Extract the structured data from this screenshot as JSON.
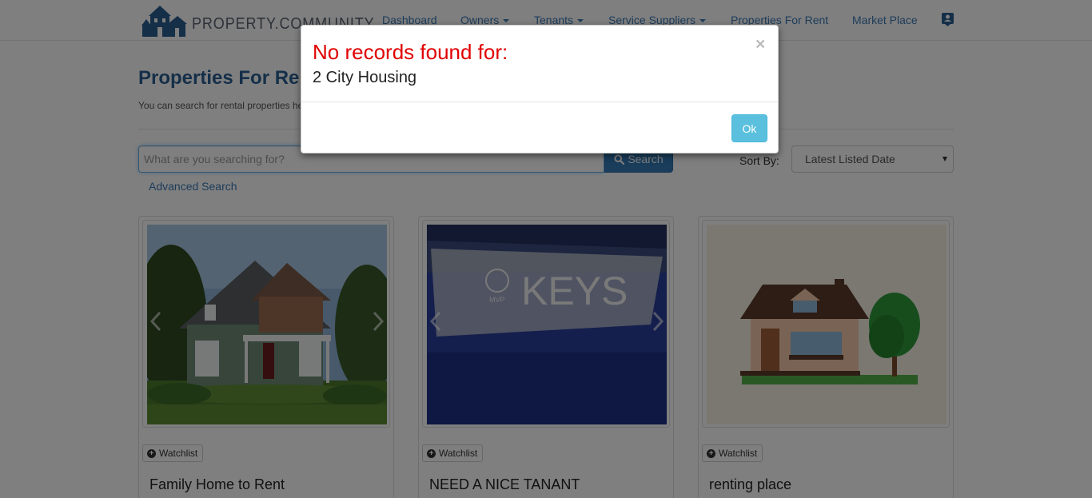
{
  "app": {
    "logo_text": "PROPERTY.COMMUNITY"
  },
  "nav": {
    "items": [
      {
        "label": "Dashboard",
        "dropdown": false
      },
      {
        "label": "Owners",
        "dropdown": true
      },
      {
        "label": "Tenants",
        "dropdown": true
      },
      {
        "label": "Service Suppliers",
        "dropdown": true
      },
      {
        "label": "Properties For Rent",
        "dropdown": false
      },
      {
        "label": "Market Place",
        "dropdown": false
      }
    ],
    "profile_icon": "profile-icon"
  },
  "page": {
    "title": "Properties For Rent",
    "subtitle": "You can search for rental properties here."
  },
  "search": {
    "placeholder": "What are you searching for?",
    "value": "",
    "button_label": "Search",
    "advanced_label": "Advanced Search"
  },
  "sort": {
    "label": "Sort By:",
    "selected": "Latest Listed Date"
  },
  "listings": [
    {
      "title": "Family Home to Rent",
      "watchlist_label": "Watchlist",
      "image": "craftsman-house-photo"
    },
    {
      "title": "NEED A NICE TANANT",
      "watchlist_label": "Watchlist",
      "image": "keys-sign-photo"
    },
    {
      "title": "renting place",
      "watchlist_label": "Watchlist",
      "image": "house-illustration"
    }
  ],
  "modal": {
    "title": "No records found for:",
    "query": "2 City Housing",
    "close_glyph": "×",
    "ok_label": "Ok",
    "title_color": "#e00000"
  },
  "colors": {
    "link": "#3a78b5",
    "primary_button": "#337ab7",
    "info_button": "#5bc0de"
  }
}
